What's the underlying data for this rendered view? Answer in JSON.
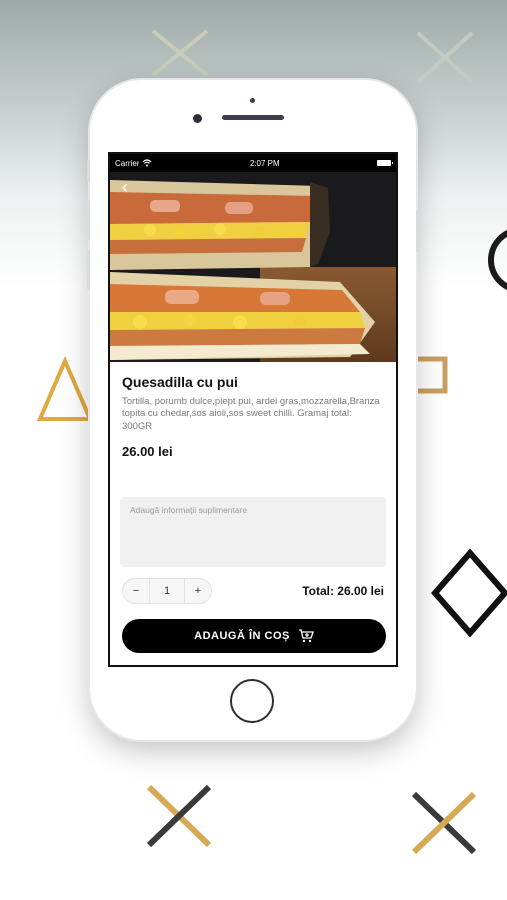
{
  "status_bar": {
    "carrier": "Carrier",
    "time": "2:07 PM"
  },
  "product": {
    "name": "Quesadilla cu pui",
    "description": "Tortilla, porumb dulce,piept pui, ardei gras,mozzarella,Branza topita cu chedar,sos aioli,sos sweet chilli. Gramaj total: 300GR",
    "price": "26.00 lei"
  },
  "notes": {
    "placeholder": "Adaugă informații suplimentare"
  },
  "quantity": {
    "minus": "−",
    "value": "1",
    "plus": "+"
  },
  "total": {
    "label": "Total: 26.00 lei"
  },
  "cart_button": {
    "label": "ADAUGĂ ÎN COȘ"
  },
  "icons": {
    "back": "chevron-left-icon",
    "wifi": "wifi-icon",
    "battery": "battery-icon",
    "cart": "add-to-cart-icon"
  },
  "colors": {
    "accent": "#e0a83e",
    "button": "#000000",
    "text": "#111111"
  }
}
